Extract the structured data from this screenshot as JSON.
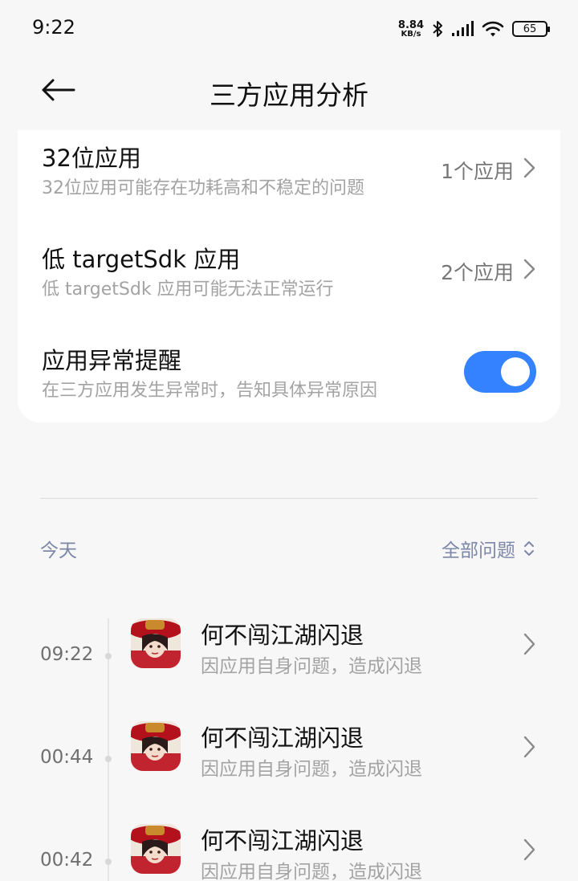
{
  "status_bar": {
    "time": "9:22",
    "net_speed_value": "8.84",
    "net_speed_unit": "KB/s",
    "battery": "65",
    "icons": [
      "bluetooth-icon",
      "signal-icon",
      "wifi-icon",
      "battery-icon"
    ]
  },
  "header": {
    "title": "三方应用分析",
    "back_icon": "arrow-left-icon"
  },
  "settings": [
    {
      "title": "32位应用",
      "subtitle": "32位应用可能存在功耗高和不稳定的问题",
      "value": "1个应用"
    },
    {
      "title": "低 targetSdk 应用",
      "subtitle": "低 targetSdk 应用可能无法正常运行",
      "value": "2个应用"
    },
    {
      "title": "应用异常提醒",
      "subtitle": "在三方应用发生异常时，告知具体异常原因",
      "toggle_on": true
    }
  ],
  "list_header": {
    "date": "今天",
    "filter": "全部问题"
  },
  "logs": [
    {
      "time": "09:22",
      "app": "何不闯江湖闪退",
      "desc": "因应用自身问题，造成闪退"
    },
    {
      "time": "00:44",
      "app": "何不闯江湖闪退",
      "desc": "因应用自身问题，造成闪退"
    },
    {
      "time": "00:42",
      "app": "何不闯江湖闪退",
      "desc": "因应用自身问题，造成闪退"
    }
  ],
  "colors": {
    "accent": "#3482ff",
    "background": "#f7f7f7",
    "card": "#ffffff",
    "muted_text": "#a3a3a3",
    "link_text": "#7d87a8"
  }
}
